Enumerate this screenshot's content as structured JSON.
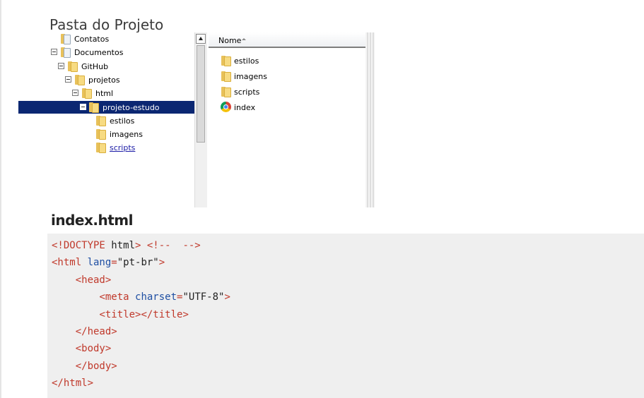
{
  "page": {
    "title": "Pasta do Projeto"
  },
  "explorer": {
    "tree": [
      {
        "label": "Contatos",
        "toggle": false,
        "selected": false,
        "link": false,
        "folder": "doc"
      },
      {
        "label": "Documentos",
        "toggle": true,
        "selected": false,
        "link": false,
        "folder": "doc"
      },
      {
        "label": "GitHub",
        "toggle": true,
        "selected": false,
        "link": false,
        "folder": "normal"
      },
      {
        "label": "projetos",
        "toggle": true,
        "selected": false,
        "link": false,
        "folder": "normal"
      },
      {
        "label": "html",
        "toggle": true,
        "selected": false,
        "link": false,
        "folder": "normal"
      },
      {
        "label": "projeto-estudo",
        "toggle": true,
        "selected": true,
        "link": false,
        "folder": "normal"
      },
      {
        "label": "estilos",
        "toggle": false,
        "selected": false,
        "link": false,
        "folder": "normal"
      },
      {
        "label": "imagens",
        "toggle": false,
        "selected": false,
        "link": false,
        "folder": "normal"
      },
      {
        "label": "scripts",
        "toggle": false,
        "selected": false,
        "link": true,
        "folder": "normal"
      }
    ],
    "column_header": "Nome",
    "files": [
      {
        "name": "estilos",
        "icon": "folder-icon"
      },
      {
        "name": "imagens",
        "icon": "folder-icon"
      },
      {
        "name": "scripts",
        "icon": "folder-icon"
      },
      {
        "name": "index",
        "icon": "chrome-icon"
      }
    ]
  },
  "code": {
    "filename": "index.html",
    "lines": [
      [
        [
          "tag",
          "<!DOCTYPE "
        ],
        [
          "text",
          "html"
        ],
        [
          "tag",
          "> "
        ],
        [
          "comment",
          "<!--  -->"
        ]
      ],
      [
        [
          "tag",
          "<html "
        ],
        [
          "attr",
          "lang"
        ],
        [
          "tag",
          "="
        ],
        [
          "val",
          "\"pt-br\""
        ],
        [
          "tag",
          ">"
        ]
      ],
      [
        [
          "text",
          "    "
        ],
        [
          "tag",
          "<head>"
        ]
      ],
      [
        [
          "text",
          "        "
        ],
        [
          "tag",
          "<meta "
        ],
        [
          "attr",
          "charset"
        ],
        [
          "tag",
          "="
        ],
        [
          "val",
          "\"UTF-8\""
        ],
        [
          "tag",
          ">"
        ]
      ],
      [
        [
          "text",
          "        "
        ],
        [
          "tag",
          "<title></title>"
        ]
      ],
      [
        [
          "text",
          "    "
        ],
        [
          "tag",
          "</head>"
        ]
      ],
      [
        [
          "text",
          "    "
        ],
        [
          "tag",
          "<body>"
        ]
      ],
      [
        [
          "text",
          "    "
        ],
        [
          "tag",
          "</body>"
        ]
      ],
      [
        [
          "tag",
          "</html>"
        ]
      ]
    ]
  }
}
